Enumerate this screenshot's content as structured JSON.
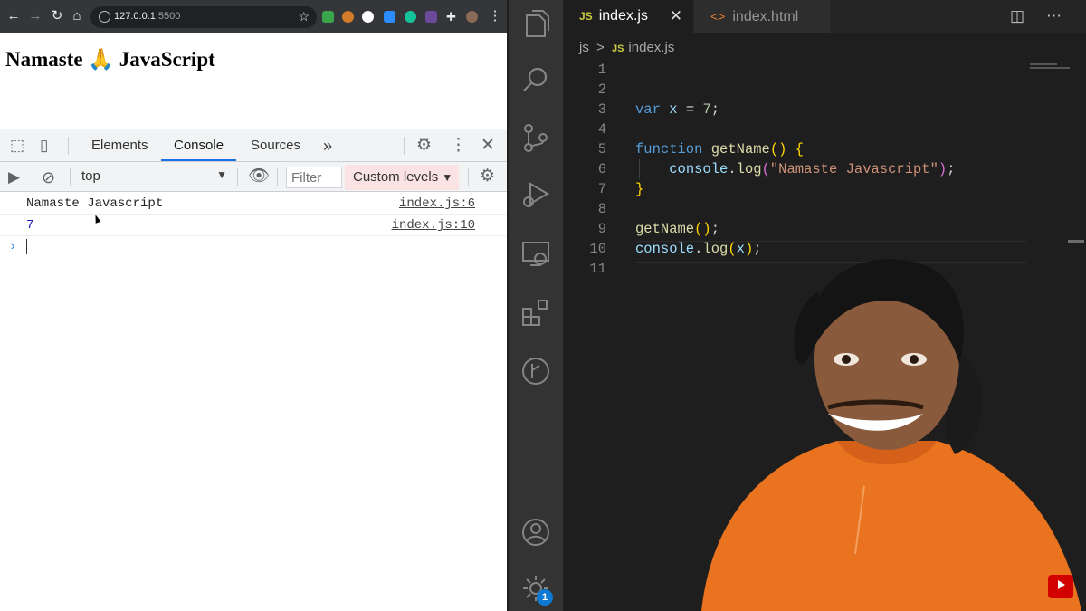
{
  "browser": {
    "url_host": "127.0.0.1",
    "url_port": ":5500",
    "page_heading": "Namaste 🙏 JavaScript"
  },
  "devtools": {
    "tabs": [
      "Elements",
      "Console",
      "Sources"
    ],
    "active_tab": "Console",
    "more_tabs": "»",
    "context": "top",
    "filter_placeholder": "Filter",
    "levels_label": "Custom levels",
    "logs": [
      {
        "message": "Namaste Javascript",
        "source": "index.js:6"
      },
      {
        "message": "7",
        "source": "index.js:10"
      }
    ],
    "prompt_symbol": "›"
  },
  "vscode": {
    "tabs": [
      {
        "badge": "JS",
        "label": "index.js",
        "active": true
      },
      {
        "badge": "<>",
        "label": "index.html",
        "active": false
      }
    ],
    "breadcrumb": {
      "folder": "js",
      "separator": ">",
      "badge": "JS",
      "file": "index.js"
    },
    "line_numbers": [
      "1",
      "2",
      "3",
      "4",
      "5",
      "6",
      "7",
      "8",
      "9",
      "10",
      "11"
    ],
    "code": {
      "l3": {
        "kw": "var",
        "name": "x",
        "op": " = ",
        "num": "7",
        "end": ";"
      },
      "l5": {
        "kw": "function",
        "name": "getName",
        "parens": "()",
        "brace": "{"
      },
      "l6": {
        "obj": "console",
        "dot": ".",
        "method": "log",
        "open": "(",
        "str": "\"Namaste Javascript\"",
        "close": ")",
        "end": ";"
      },
      "l7": {
        "brace": "}"
      },
      "l9": {
        "name": "getName",
        "parens": "()",
        "end": ";"
      },
      "l10": {
        "obj": "console",
        "dot": ".",
        "method": "log",
        "open": "(",
        "arg": "x",
        "close": ")",
        "end": ";"
      }
    },
    "notification_count": "1"
  },
  "colors": {
    "vscode_bg": "#1e1e1e",
    "activity_bar": "#333333",
    "keyword": "#569cd6",
    "function": "#dcdcaa",
    "string": "#ce9178",
    "devtools_active": "#1a73e8",
    "custom_levels_bg": "#fbe3e4"
  }
}
